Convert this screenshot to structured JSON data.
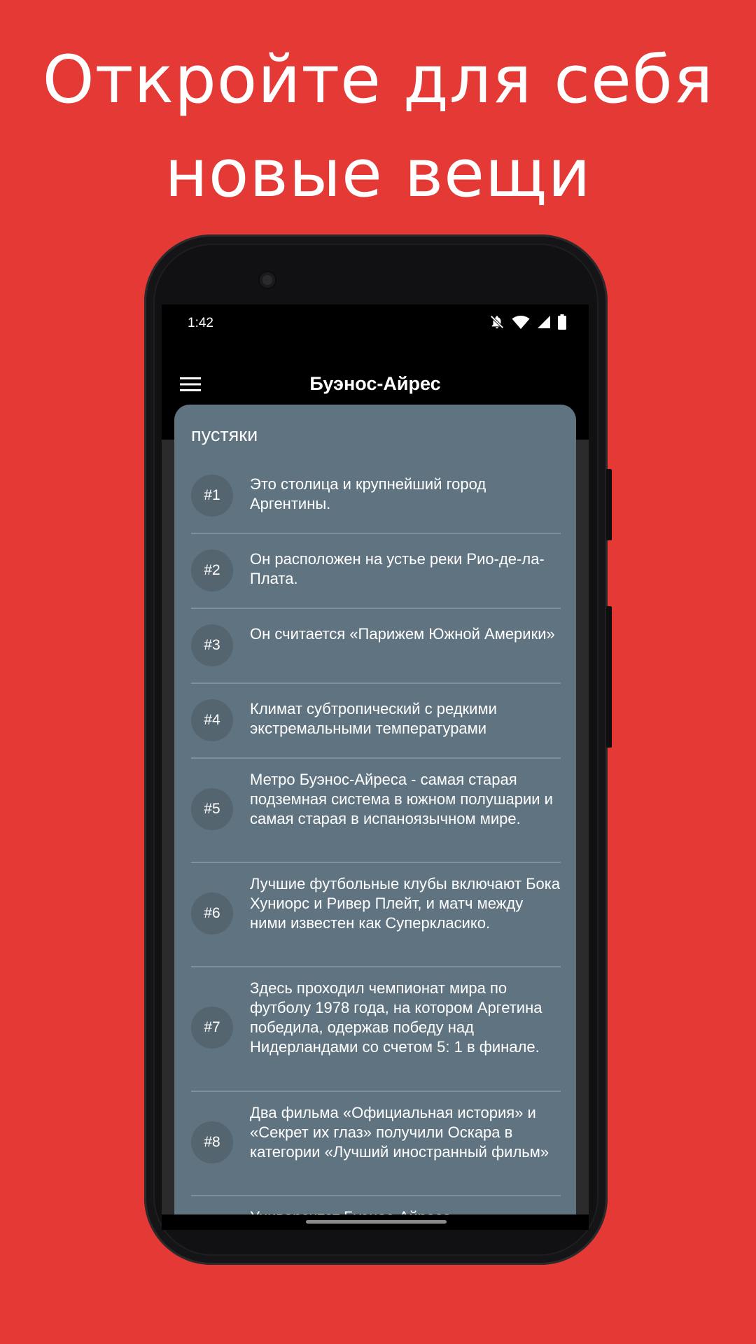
{
  "promo": {
    "line1": "Откройте для себя",
    "line2": "новые вещи"
  },
  "status_bar": {
    "time": "1:42",
    "icons": [
      "bell-off-icon",
      "wifi-icon",
      "signal-icon",
      "battery-icon"
    ]
  },
  "app_bar": {
    "title": "Буэнос-Айрес",
    "menu_icon": "menu-icon"
  },
  "card": {
    "title": "пустяки",
    "items": [
      {
        "number": "#1",
        "text": "Это столица и крупнейший город Аргентины."
      },
      {
        "number": "#2",
        "text": "Он расположен на устье реки Рио-де-ла-Плата."
      },
      {
        "number": "#3",
        "text": "Он считается «Парижем Южной Америки»"
      },
      {
        "number": "#4",
        "text": "Климат субтропический с редкими экстремальными температурами"
      },
      {
        "number": "#5",
        "text": "Метро Буэнос-Айреса - самая старая подземная система в южном полушарии и самая старая в испаноязычном мире."
      },
      {
        "number": "#6",
        "text": "Лучшие футбольные клубы включают Бока Хуниорс и Ривер Плейт, и матч между ними известен как Суперкласико."
      },
      {
        "number": "#7",
        "text": "Здесь проходил чемпионат мира по футболу 1978 года, на котором Аргетина победила, одержав победу над Нидерландами со счетом 5: 1 в финале."
      },
      {
        "number": "#8",
        "text": "Два фильма «Официальная история» и «Секрет их глаз» получили Оскара в категории «Лучший иностранный фильм»"
      },
      {
        "number": "",
        "text": "Университет Буэнос-Айреса"
      }
    ]
  },
  "colors": {
    "background": "#e53935",
    "card": "#5f7380",
    "badge": "#54656f"
  }
}
